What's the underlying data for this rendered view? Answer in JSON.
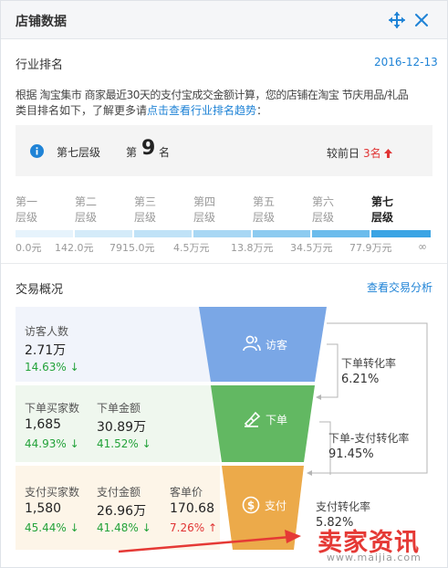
{
  "header": {
    "title": "店铺数据"
  },
  "ranking": {
    "title": "行业排名",
    "date": "2016-12-13",
    "desc_line1": "根据 淘宝集市 商家最近30天的支付宝成交金额计算，您的店铺在淘宝 节庆用品/礼品",
    "desc_line2_prefix": "类目排名如下，了解更多请",
    "desc_link": "点击查看行业排名趋势",
    "desc_suffix": "：",
    "level": "第七层级",
    "rank_prefix": "第",
    "rank_value": "9",
    "rank_suffix": "名",
    "compare_label": "较前日",
    "compare_value": "3名",
    "tiers": [
      {
        "line1": "第一",
        "line2": "层级"
      },
      {
        "line1": "第二",
        "line2": "层级"
      },
      {
        "line1": "第三",
        "line2": "层级"
      },
      {
        "line1": "第四",
        "line2": "层级"
      },
      {
        "line1": "第五",
        "line2": "层级"
      },
      {
        "line1": "第六",
        "line2": "层级"
      },
      {
        "line1": "第七",
        "line2": "层级"
      }
    ],
    "ticks": [
      "0.0元",
      "142.0元",
      "7915.0元",
      "4.5万元",
      "13.8万元",
      "34.5万元",
      "77.9万元",
      "∞"
    ],
    "active_tier": 7
  },
  "trade": {
    "title": "交易概况",
    "link": "查看交易分析",
    "visitors": {
      "label": "访客人数",
      "value": "2.71万",
      "change": "14.63%"
    },
    "order_buyers": {
      "label": "下单买家数",
      "value": "1,685",
      "change": "44.93%"
    },
    "order_amount": {
      "label": "下单金额",
      "value": "30.89万",
      "change": "41.52%"
    },
    "pay_buyers": {
      "label": "支付买家数",
      "value": "1,580",
      "change": "45.44%"
    },
    "pay_amount": {
      "label": "支付金额",
      "value": "26.96万",
      "change": "41.48%"
    },
    "unit_price": {
      "label": "客单价",
      "value": "170.68",
      "change": "7.26%"
    },
    "funnel": {
      "visit": "访客",
      "order": "下单",
      "pay": "支付"
    },
    "conversions": [
      {
        "label": "下单转化率",
        "value": "6.21%"
      },
      {
        "label": "下单-支付转化率",
        "value": "91.45%"
      },
      {
        "label": "支付转化率",
        "value": "5.82%"
      }
    ]
  },
  "watermark": {
    "text": "卖家资讯",
    "url": "www.maijia.com"
  },
  "colors": {
    "accent": "#1f83d6",
    "up_green": "#23a23a",
    "up_red": "#e03434",
    "funnel_blue": "#7aa7e6",
    "funnel_green": "#62b862",
    "funnel_orange": "#ecaa4a"
  }
}
